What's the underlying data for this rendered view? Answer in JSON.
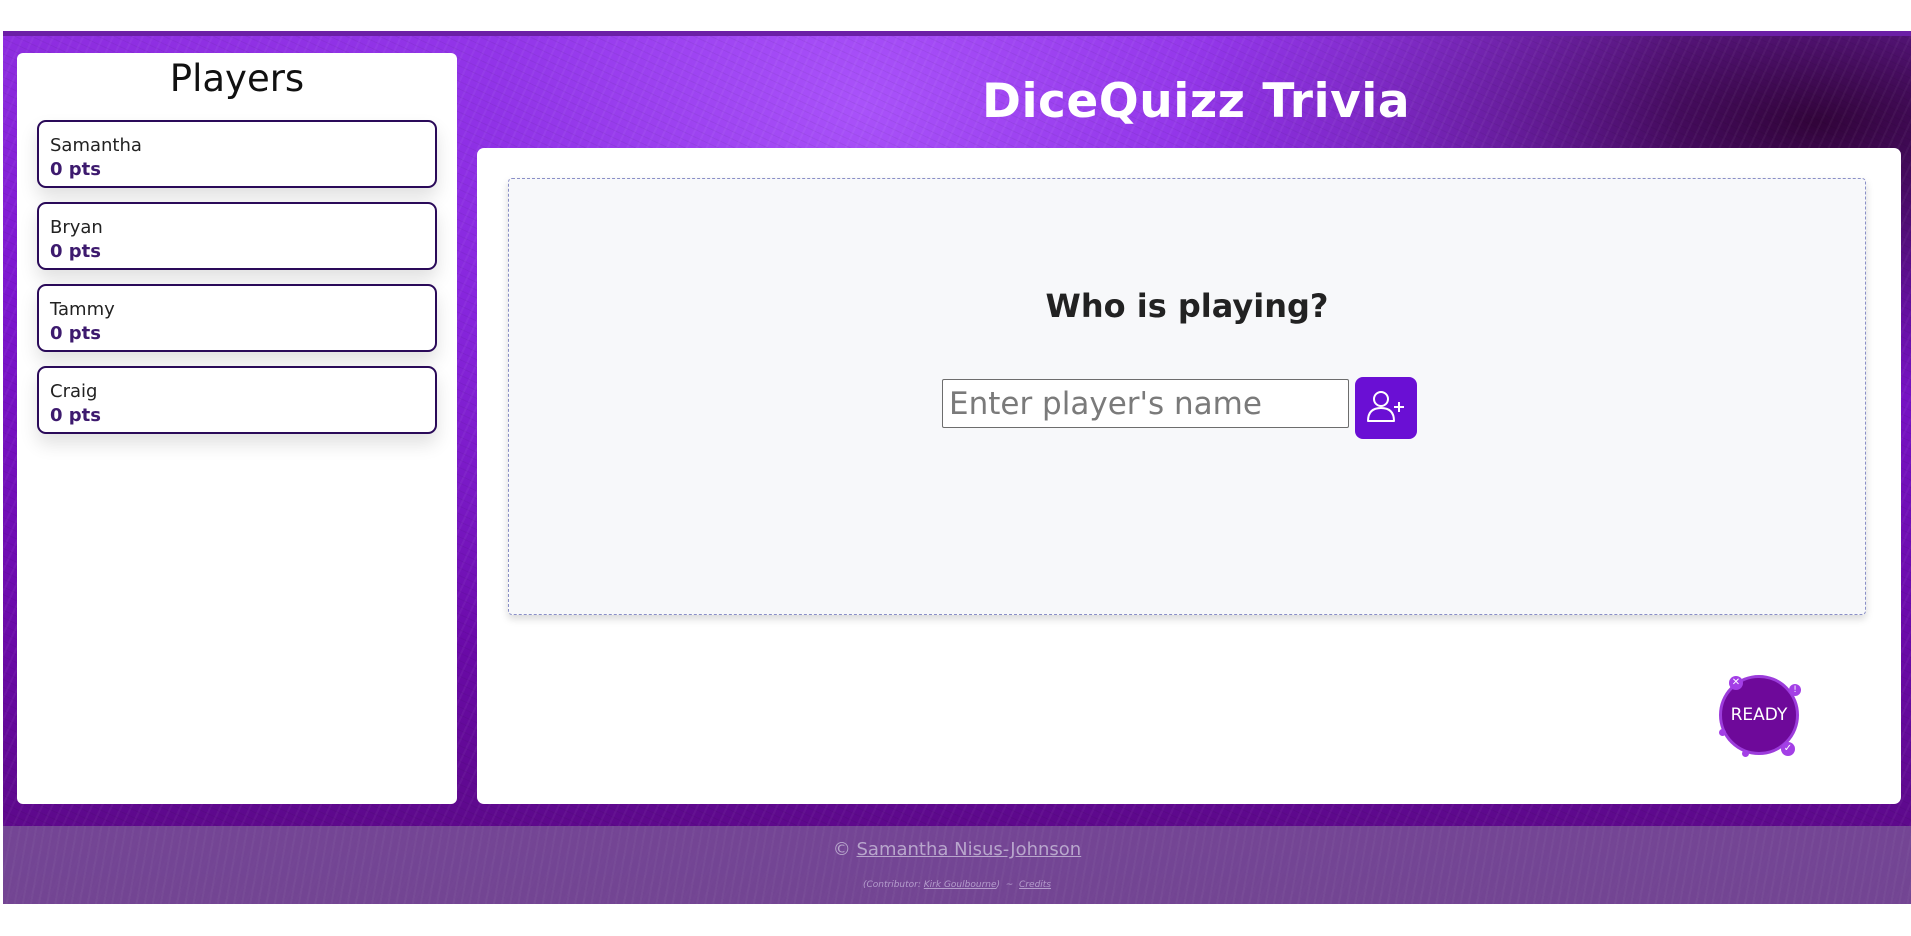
{
  "app": {
    "title": "DiceQuizz Trivia"
  },
  "sidebar": {
    "title": "Players",
    "players": [
      {
        "name": "Samantha",
        "points": "0 pts"
      },
      {
        "name": "Bryan",
        "points": "0 pts"
      },
      {
        "name": "Tammy",
        "points": "0 pts"
      },
      {
        "name": "Craig",
        "points": "0 pts"
      }
    ]
  },
  "main": {
    "question": "Who is playing?",
    "name_input": {
      "placeholder": "Enter player's name",
      "value": ""
    },
    "add_player_icon": "add-user-icon",
    "ready_button": {
      "label": "READY",
      "badges": {
        "cancel": "✕",
        "alert": "!",
        "ok": "✓"
      }
    }
  },
  "footer": {
    "copyright_symbol": "©",
    "author": "Samantha Nisus-Johnson",
    "contributor_prefix": "(Contributor:",
    "contributor": "Kirk Goulbourne",
    "contributor_suffix": ")",
    "separator": "~",
    "credits": "Credits"
  },
  "colors": {
    "accent": "#6a0fd4",
    "header_bg": "#7c16cf",
    "player_border": "#2a0a59",
    "points_text": "#3d1a6e",
    "ready_bg": "#6e099a"
  }
}
